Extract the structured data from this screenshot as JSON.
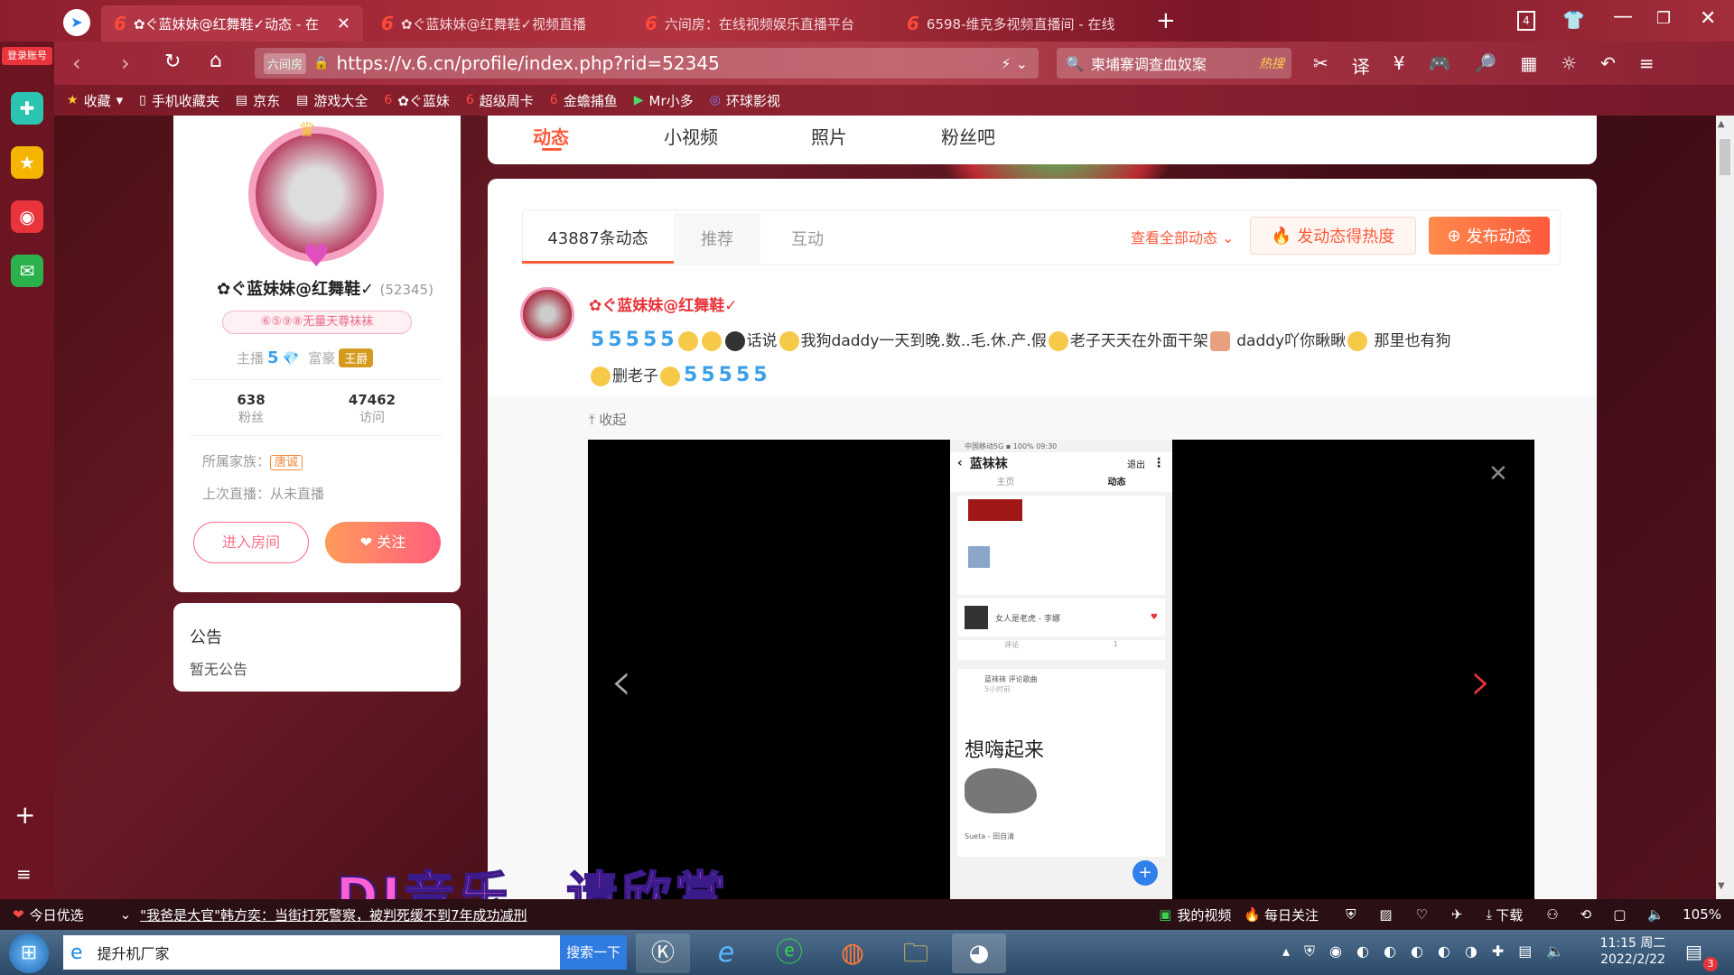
{
  "browser": {
    "left_icons": [
      "ie-logo-icon",
      "login-label",
      "plus-cross-icon",
      "star-icon",
      "weibo-icon",
      "mail-icon"
    ],
    "login_label": "登录账号",
    "tabs": [
      {
        "label": "✿ぐ蓝妹妹@红舞鞋✓动态 - 在",
        "active": true
      },
      {
        "label": "✿ぐ蓝妹妹@红舞鞋✓视频直播",
        "active": false
      },
      {
        "label": "六间房：在线视频娱乐直播平台",
        "active": false
      },
      {
        "label": "6598-维克多视频直播间 - 在线",
        "active": false
      }
    ],
    "tab_count": "4",
    "url": "https://v.6.cn/profile/index.php?rid=52345",
    "site_badge": "六间房",
    "search_text": "柬埔寨调查血奴案",
    "hot_label": "热搜",
    "bookmarks": [
      "收藏",
      "手机收藏夹",
      "京东",
      "游戏大全",
      "✿ぐ蓝妹",
      "超级周卡",
      "金蟾捕鱼",
      "Mr小多",
      "环球影视"
    ]
  },
  "profile": {
    "name": "✿ぐ蓝妹妹@红舞鞋✓",
    "rid": "(52345)",
    "fan_badge": "⑥⑤⑨⑧无量天尊袜袜",
    "anchor_label": "主播",
    "anchor_level": "5",
    "rich_label": "富豪",
    "rich_badge": "王爵",
    "fans_count": "638",
    "fans_label": "粉丝",
    "visits_count": "47462",
    "visits_label": "访问",
    "family_label": "所属家族：",
    "family_value": "唐诚",
    "last_live": "上次直播：从未直播",
    "enter_room": "进入房间",
    "follow": "关注"
  },
  "notice": {
    "title": "公告",
    "content": "暂无公告"
  },
  "nav": {
    "tabs": [
      "动态",
      "小视频",
      "照片",
      "粉丝吧"
    ],
    "active": "动态"
  },
  "feed": {
    "tabs": [
      "43887条动态",
      "推荐",
      "互动"
    ],
    "view_all": "查看全部动态",
    "heat_button": "发动态得热度",
    "post_button": "发布动态",
    "post": {
      "author": "✿ぐ蓝妹妹@红舞鞋✓",
      "text_a": "话说",
      "text_b": "我狗daddy一天到晚.数..毛.休.产.假",
      "text_c": "老子天天在外面干架",
      "text_d": "daddy吖你瞅瞅",
      "text_e": "那里也有狗",
      "text_f": "删老子",
      "collapse": "收起"
    },
    "phone": {
      "status": "中国移动5G ▪ 100% 09:30",
      "title": "蓝袜袜",
      "exit": "退出",
      "tab_home": "主页",
      "tab_dynamic": "动态",
      "song": "女人是老虎 - 李娜",
      "comment": "评论",
      "likes": "1",
      "user2": "蓝袜袜 评论歌曲",
      "user2_time": "5小时前",
      "big_text": "想嗨起来",
      "song2": "Sueta - 田自清"
    }
  },
  "overlay_caption": "DJ音乐，请欣赏",
  "statusbar": {
    "today": "今日优选",
    "news": "\"我爸是大官\"韩方奕：当街打死警察，被判死缓不到7年成功减刑",
    "my_video": "我的视频",
    "daily": "每日关注",
    "download": "下载",
    "zoom": "105%"
  },
  "taskbar": {
    "ie_label": "提升机厂家",
    "search_button": "搜索一下",
    "time": "11:15 周二",
    "date": "2022/2/22",
    "badge": "3"
  },
  "colors": {
    "accent": "#ff5a3c",
    "brand_red": "#e8343a",
    "pink": "#ff6f8a"
  }
}
